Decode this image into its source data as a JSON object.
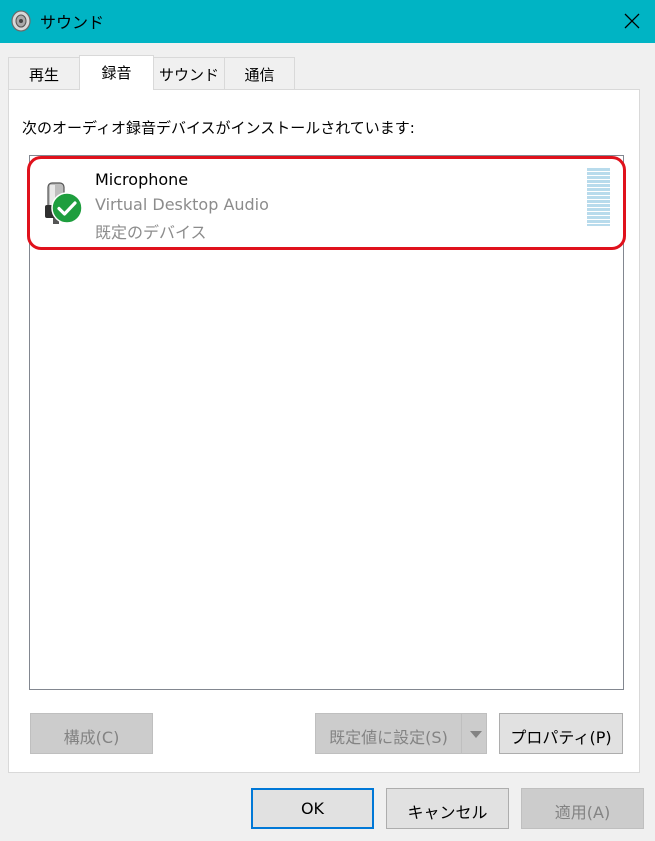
{
  "window": {
    "title": "サウンド",
    "icon": "speaker-icon"
  },
  "tabs": [
    {
      "label": "再生"
    },
    {
      "label": "録音"
    },
    {
      "label": "サウンド"
    },
    {
      "label": "通信"
    }
  ],
  "panel": {
    "instruction": "次のオーディオ録音デバイスがインストールされています:"
  },
  "devices": [
    {
      "name": "Microphone",
      "description": "Virtual Desktop Audio",
      "status": "既定のデバイス",
      "icon": "microphone-icon",
      "badge": "default-check-icon"
    }
  ],
  "panel_buttons": {
    "configure": "構成(C)",
    "set_default": "既定値に設定(S)",
    "properties": "プロパティ(P)"
  },
  "dialog_buttons": {
    "ok": "OK",
    "cancel": "キャンセル",
    "apply": "適用(A)"
  },
  "colors": {
    "titlebar": "#00b4c4",
    "highlight": "#e0111c",
    "check_badge": "#1e9e3e",
    "level_meter": "#b8dbec"
  }
}
